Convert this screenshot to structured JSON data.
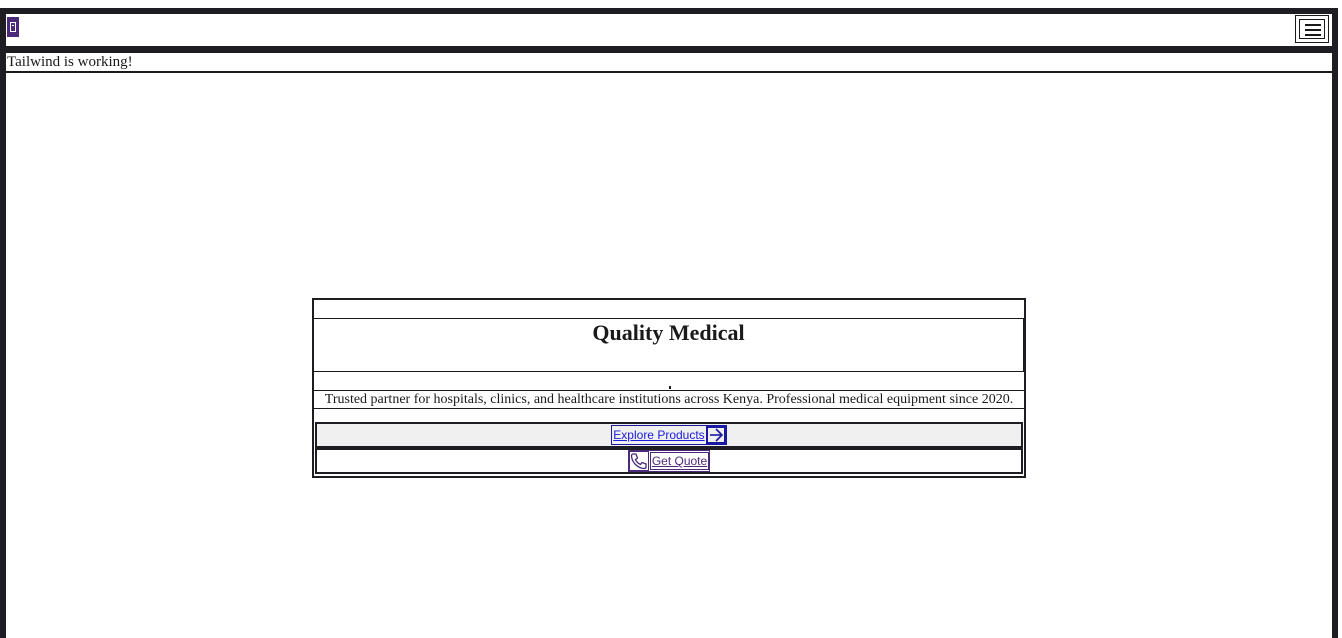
{
  "navbar": {
    "logo_icon": "logo-icon",
    "menu_icon": "hamburger-menu-icon"
  },
  "status": {
    "text": "Tailwind is working!"
  },
  "hero": {
    "title": "Quality Medical",
    "description": "Trusted partner for hospitals, clinics, and healthcare institutions across Kenya. Professional medical equipment since 2020.",
    "explore_label": "Explore Products",
    "explore_icon": "arrow-right-icon",
    "quote_label": "Get Quote",
    "quote_icon": "phone-icon"
  },
  "colors": {
    "frame": "#1f1d24",
    "brand_purple": "#4b2a7a",
    "link_blue": "#1a1ae0",
    "explore_row_bg": "#f0f0f0"
  }
}
